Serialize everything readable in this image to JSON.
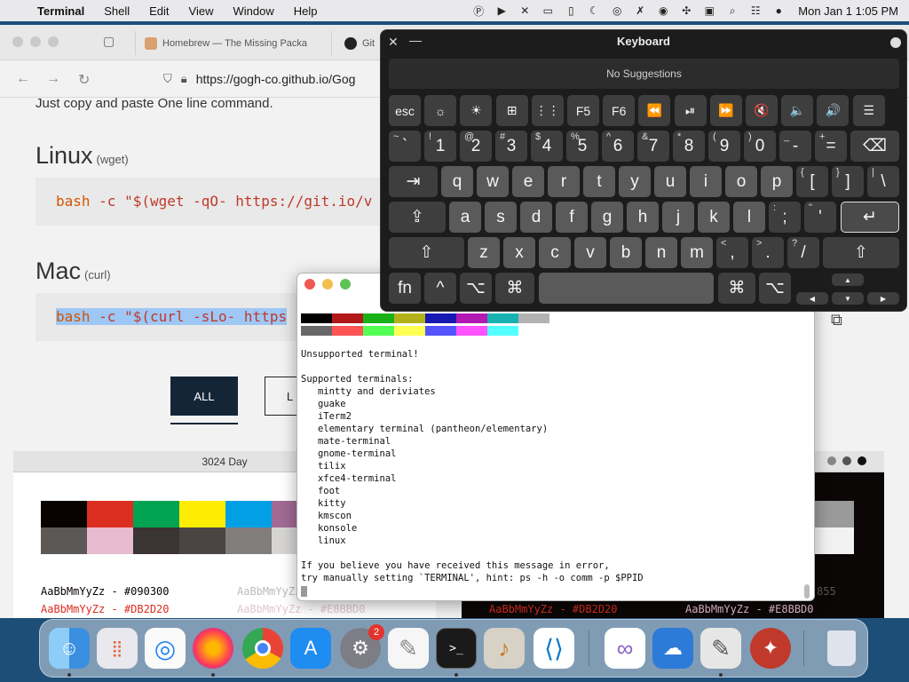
{
  "menubar": {
    "app": "Terminal",
    "items": [
      "Shell",
      "Edit",
      "View",
      "Window",
      "Help"
    ],
    "clock": "Mon Jan 1  1:05 PM"
  },
  "browser": {
    "tabs": [
      {
        "label": "Homebrew — The Missing Packa"
      },
      {
        "label": "Git"
      }
    ],
    "url": "https://gogh-co.github.io/Gog",
    "intro": "Just copy and paste One line command.",
    "linux": {
      "heading": "Linux",
      "tool": "(wget)",
      "cmd_kw": "bash",
      "cmd_rest": " -c  \"$(wget -qO- https://git.io/v"
    },
    "mac": {
      "heading": "Mac",
      "tool": "(curl)",
      "cmd_kw": "bash",
      "cmd_rest": " -c  \"$(curl -sLo- https"
    },
    "filters": {
      "all": "ALL",
      "linux": "L"
    },
    "card_left": {
      "title": "3024 Day",
      "sample_fg": "AaBbMmYyZz - #090300",
      "sample_fg2": "AaBbMmYyZz - #DB2D20",
      "sample_faint": "AaBbMmYyZz",
      "sample_faint2": "AaBbMmYyZz - #E8BBD0",
      "colors_top": [
        "#090300",
        "#db2d20",
        "#01a252",
        "#fded02",
        "#01a0e4",
        "#a16a94"
      ],
      "colors_bottom": [
        "#5c5855",
        "#e8bbd0",
        "#3a3432",
        "#4a4543",
        "#807d7c",
        "#d6d5d4"
      ]
    },
    "card_right": {
      "sample_red": "AaBbMmYyZz - #DB2D20",
      "sample_light": "AaBbMmYyZz - #E8BBD0",
      "sample_faint": "855"
    }
  },
  "terminal": {
    "palette_dark": [
      "#000000",
      "#b21818",
      "#18b218",
      "#b2b218",
      "#1818b2",
      "#b218b2",
      "#18b2b2",
      "#b2b2b2"
    ],
    "palette_light": [
      "#686868",
      "#ff5454",
      "#54ff54",
      "#ffff54",
      "#5454ff",
      "#ff54ff",
      "#54ffff",
      "#ffffff"
    ],
    "output": "Unsupported terminal!\n\nSupported terminals:\n   mintty and deriviates\n   guake\n   iTerm2\n   elementary terminal (pantheon/elementary)\n   mate-terminal\n   gnome-terminal\n   tilix\n   xfce4-terminal\n   foot\n   kitty\n   kmscon\n   konsole\n   linux\n\nIf you believe you have received this message in error,\ntry manually setting `TERMINAL', hint: ps -h -o comm -p $PPID"
  },
  "keyboard": {
    "title": "Keyboard",
    "suggestions": "No Suggestions",
    "fn_row": [
      "esc",
      "☼",
      "☀",
      "⊞",
      "⋮⋮",
      "F5",
      "F6",
      "⏪",
      "⏯",
      "⏩",
      "🔇",
      "🔈",
      "🔊",
      "☰"
    ],
    "num_row": [
      [
        "~",
        "`"
      ],
      [
        "!",
        "1"
      ],
      [
        "@",
        "2"
      ],
      [
        "#",
        "3"
      ],
      [
        "$",
        "4"
      ],
      [
        "%",
        "5"
      ],
      [
        "^",
        "6"
      ],
      [
        "&",
        "7"
      ],
      [
        "*",
        "8"
      ],
      [
        "(",
        "9"
      ],
      [
        ")",
        "0"
      ],
      [
        "_",
        "-"
      ],
      [
        "+",
        "="
      ]
    ],
    "delete": "⌫",
    "tab": "⇥",
    "row_q": [
      [
        "",
        "q"
      ],
      [
        "",
        "w"
      ],
      [
        "",
        "e"
      ],
      [
        "",
        "r"
      ],
      [
        "",
        "t"
      ],
      [
        "",
        "y"
      ],
      [
        "",
        "u"
      ],
      [
        "",
        "i"
      ],
      [
        "",
        "o"
      ],
      [
        "",
        "p"
      ],
      [
        "{",
        "["
      ],
      [
        "}",
        "]"
      ],
      [
        "|",
        "\\"
      ]
    ],
    "caps": "⇪",
    "row_a": [
      [
        "",
        "a"
      ],
      [
        "",
        "s"
      ],
      [
        "",
        "d"
      ],
      [
        "",
        "f"
      ],
      [
        "",
        "g"
      ],
      [
        "",
        "h"
      ],
      [
        "",
        "j"
      ],
      [
        "",
        "k"
      ],
      [
        "",
        "l"
      ],
      [
        ":",
        ";"
      ],
      [
        "\"",
        "'"
      ]
    ],
    "return": "↵",
    "shift": "⇧",
    "row_z": [
      [
        "",
        "z"
      ],
      [
        "",
        "x"
      ],
      [
        "",
        "c"
      ],
      [
        "",
        "v"
      ],
      [
        "",
        "b"
      ],
      [
        "",
        "n"
      ],
      [
        "",
        "m"
      ],
      [
        "<",
        ","
      ],
      [
        ">",
        "."
      ],
      [
        "?",
        "/"
      ]
    ],
    "bottom": {
      "fn": "fn",
      "ctrl": "^",
      "opt": "⌥",
      "cmd": "⌘",
      "up": "▲",
      "left": "◀",
      "down": "▼",
      "right": "▶"
    }
  },
  "dock": {
    "settings_badge": "2"
  }
}
